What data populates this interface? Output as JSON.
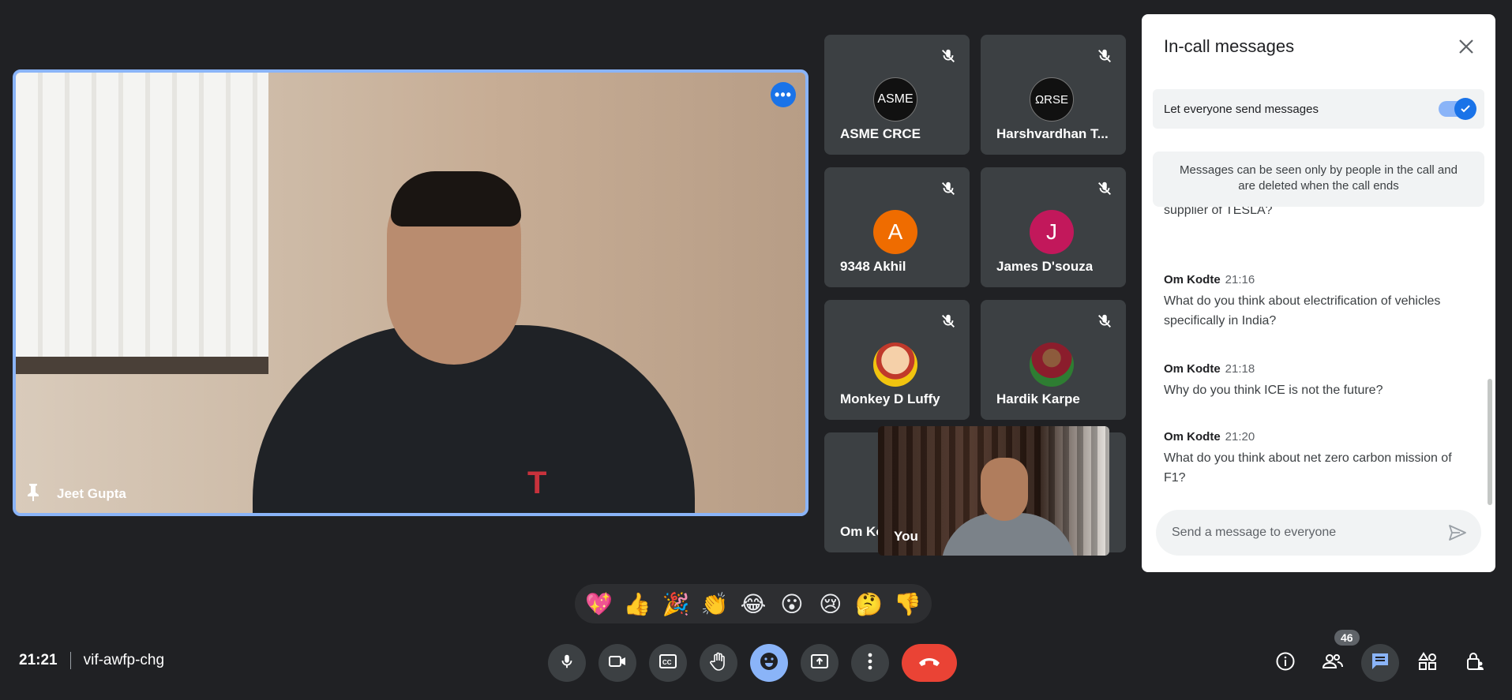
{
  "main_speaker": {
    "name": "Jeet Gupta"
  },
  "participants": [
    {
      "name": "ASME CRCE",
      "avatar_text": "ASME",
      "avatar_color": "#111111"
    },
    {
      "name": "Harshvardhan T...",
      "avatar_text": "ΩRSE",
      "avatar_color": "#111111"
    },
    {
      "name": "9348 Akhil",
      "avatar_text": "A",
      "avatar_color": "#ef6c00"
    },
    {
      "name": "James D'souza",
      "avatar_text": "J",
      "avatar_color": "#c2185b"
    },
    {
      "name": "Monkey D Luffy",
      "avatar_text": "",
      "avatar_color": "#f4a460"
    },
    {
      "name": "Hardik Karpe",
      "avatar_text": "",
      "avatar_color": "#2e7d32"
    },
    {
      "name": "Om Ko",
      "avatar_text": "",
      "avatar_color": "#3c4043"
    }
  ],
  "self_view": {
    "label": "You"
  },
  "chat": {
    "title": "In-call messages",
    "toggle_label": "Let everyone send messages",
    "notice": "Messages can be seen only by people in the call and are deleted when the call ends",
    "partial_message": "supplier of TESLA?",
    "messages": [
      {
        "sender": "Om Kodte",
        "time": "21:16",
        "text": "What do you think about electrification of vehicles specifically in India?"
      },
      {
        "sender": "Om Kodte",
        "time": "21:18",
        "text": "Why do you think ICE is not the future?"
      },
      {
        "sender": "Om Kodte",
        "time": "21:20",
        "text": "What do you think about net zero carbon mission of F1?"
      }
    ],
    "input_placeholder": "Send a message to everyone"
  },
  "reactions": [
    "💖",
    "👍",
    "🎉",
    "👏",
    "😂",
    "😮",
    "😢",
    "🤔",
    "👎"
  ],
  "meeting": {
    "time": "21:21",
    "code": "vif-awfp-chg"
  },
  "people_count": "46",
  "colors": {
    "accent": "#8ab4f8",
    "end_call": "#ea4335",
    "background": "#202124",
    "tile": "#3c4043"
  }
}
